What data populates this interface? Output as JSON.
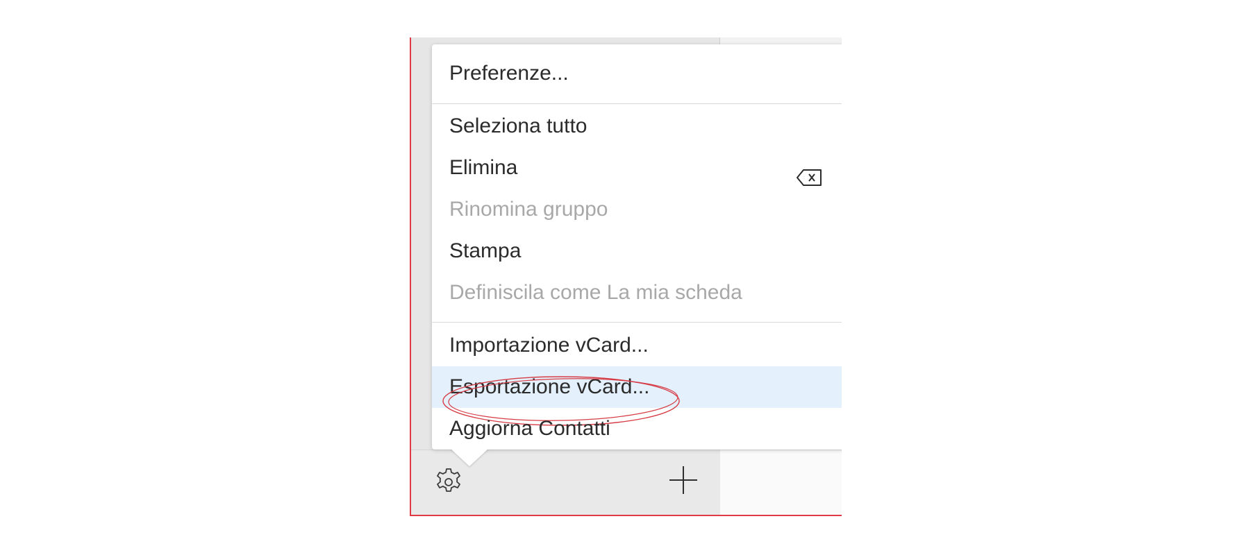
{
  "menu": {
    "items": [
      {
        "label": "Preferenze..."
      },
      {
        "label": "Seleziona tutto"
      },
      {
        "label": "Elimina",
        "shortcut_icon": "delete-key-icon"
      },
      {
        "label": "Rinomina gruppo",
        "disabled": true
      },
      {
        "label": "Stampa"
      },
      {
        "label": "Definiscila come La mia scheda",
        "disabled": true
      },
      {
        "label": "Importazione vCard..."
      },
      {
        "label": "Esportazione vCard...",
        "highlighted": true,
        "annotated": true
      },
      {
        "label": "Aggiorna Contatti"
      }
    ]
  },
  "toolbar": {
    "gear_icon": "gear-icon",
    "add_icon": "plus-icon"
  },
  "colors": {
    "highlight": "#e4f0fb",
    "annotation": "#d63b45",
    "window_border": "#e03a44",
    "disabled_text": "#a8a8a8"
  }
}
